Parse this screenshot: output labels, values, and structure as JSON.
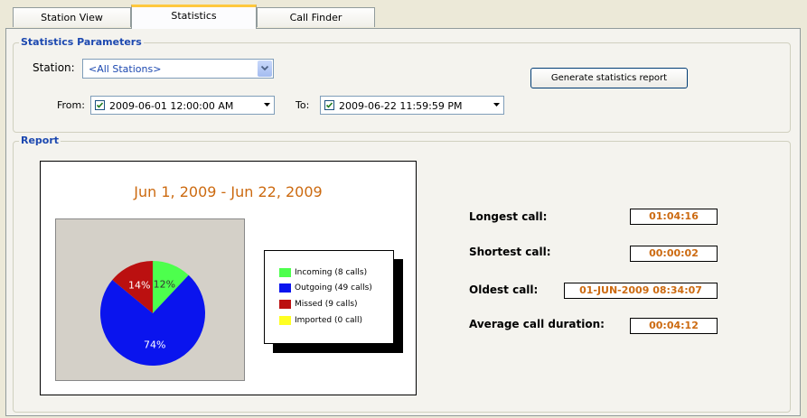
{
  "tabs": [
    {
      "label": "Station View"
    },
    {
      "label": "Statistics"
    },
    {
      "label": "Call Finder"
    }
  ],
  "parameters": {
    "title": "Statistics Parameters",
    "station_label": "Station:",
    "station_value": "<All Stations>",
    "from_label": "From:",
    "from_value": "2009-06-01 12:00:00 AM",
    "to_label": "To:",
    "to_value": "2009-06-22 11:59:59 PM",
    "generate_label": "Generate statistics report"
  },
  "report": {
    "title": "Report",
    "chart_title": "Jun 1, 2009 - Jun 22, 2009",
    "stats": [
      {
        "label": "Longest call:",
        "value": "01:04:16"
      },
      {
        "label": "Shortest call:",
        "value": "00:00:02"
      },
      {
        "label": "Oldest call:",
        "value": "01-JUN-2009 08:34:07"
      },
      {
        "label": "Average call duration:",
        "value": "00:04:12"
      }
    ]
  },
  "chart_data": {
    "type": "pie",
    "title": "Jun 1, 2009 - Jun 22, 2009",
    "categories": [
      "Incoming (8 calls)",
      "Outgoing (49 calls)",
      "Missed (9 calls)",
      "Imported (0 call)"
    ],
    "values": [
      12,
      74,
      14,
      0
    ],
    "labels": [
      "12%",
      "74%",
      "14%",
      ""
    ],
    "colors": [
      "#4dff4d",
      "#0a14ee",
      "#bb1010",
      "#ffff22"
    ],
    "legend": "right"
  }
}
